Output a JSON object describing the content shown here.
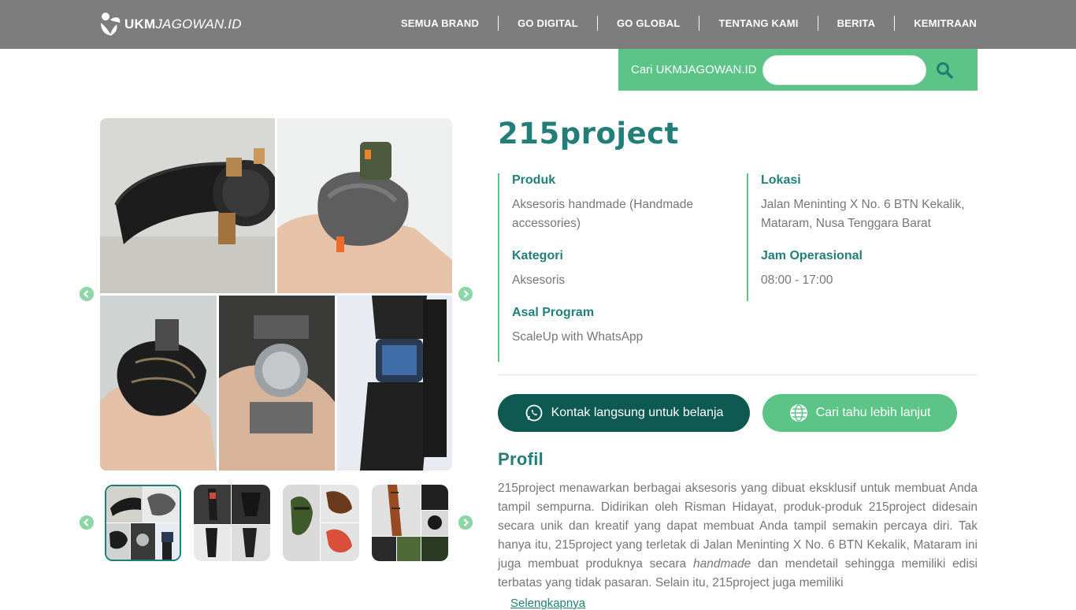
{
  "header": {
    "logo_bold": "UKM",
    "logo_italic": "JAGOWAN.ID",
    "nav": [
      "SEMUA BRAND",
      "GO DIGITAL",
      "GO GLOBAL",
      "TENTANG KAMI",
      "BERITA",
      "KEMITRAAN"
    ]
  },
  "search": {
    "label": "Cari UKMJAGOWAN.ID",
    "value": "",
    "icon": "search-icon"
  },
  "brand": {
    "name": "215project",
    "info": {
      "produk_label": "Produk",
      "produk_value": "Aksesoris handmade (Handmade accessories)",
      "kategori_label": "Kategori",
      "kategori_value": "Aksesoris",
      "asal_label": "Asal Program",
      "asal_value": "ScaleUp with WhatsApp",
      "lokasi_label": "Lokasi",
      "lokasi_value": "Jalan Meninting X No. 6 BTN Kekalik, Mataram, Nusa Tenggara Barat",
      "jam_label": "Jam Operasional",
      "jam_value": "08:00 - 17:00"
    }
  },
  "buttons": {
    "contact": "Kontak langsung untuk belanja",
    "more": "Cari tahu lebih lanjut"
  },
  "profil": {
    "title": "Profil",
    "text_before": "215project menawarkan berbagai aksesoris yang dibuat eksklusif untuk membuat Anda tampil sempurna. Didirikan oleh Risman Hidayat, produk-produk 215project didesain secara unik dan kreatif yang dapat membuat Anda tampil semakin percaya diri. Tak hanya itu, 215project yang terletak di Jalan Meninting X No. 6 BTN Kekalik, Mataram ini juga membuat produknya secara ",
    "text_italic": "handmade",
    "text_after": " dan mendetail sehingga memiliki edisi terbatas yang tidak pasaran.  Selain itu, 215project juga memiliki",
    "more_link": "Selengkapnya"
  },
  "colors": {
    "header_bg": "#7d7d7d",
    "accent_green": "#5cc487",
    "dark_teal": "#0e5a53",
    "title_teal": "#237e79"
  }
}
